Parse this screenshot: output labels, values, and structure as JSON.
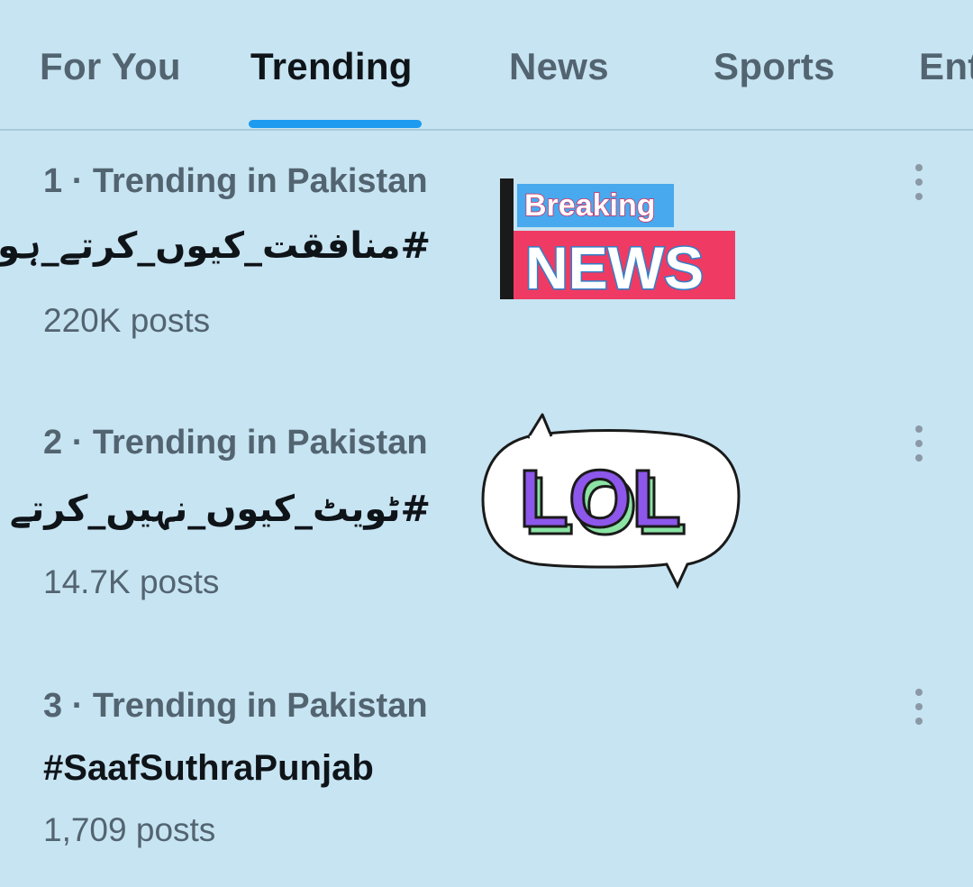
{
  "tabs": [
    {
      "label": "For You"
    },
    {
      "label": "Trending"
    },
    {
      "label": "News"
    },
    {
      "label": "Sports"
    },
    {
      "label": "Ent"
    }
  ],
  "trends": [
    {
      "meta": "1 · Trending in Pakistan",
      "title": "#منافقت_کیوں_کرتے_ہو",
      "count": "220K posts",
      "media": {
        "top_text": "Breaking",
        "bottom_text": "NEWS",
        "accent": "#ef3b63",
        "tag_color": "#48a9ee"
      }
    },
    {
      "meta": "2 · Trending in Pakistan",
      "title": "#ٹویٹ_کیوں_نہیں_کرتے",
      "count": "14.7K posts",
      "media": {
        "text": "LOL",
        "letter_color": "#8c57ea",
        "shadow_color": "#8be3a4"
      }
    },
    {
      "meta": "3 · Trending in Pakistan",
      "title": "#SaafSuthraPunjab",
      "count": "1,709 posts"
    }
  ],
  "colors": {
    "background": "#c7e4f2",
    "tab_indicator": "#1d9bf0",
    "primary_text": "#0f1419",
    "secondary_text": "#536471"
  }
}
